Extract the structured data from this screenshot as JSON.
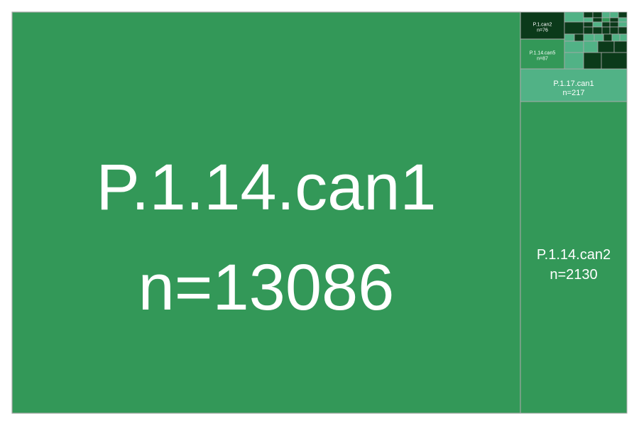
{
  "chart_data": {
    "type": "treemap",
    "colors": {
      "border": "#a9a9a9",
      "background": "#ffffff",
      "label": "#ffffff",
      "shades": [
        "#339858",
        "#51b286",
        "#2b7f48",
        "#14542b",
        "#0b3a1a",
        "#06240f"
      ]
    },
    "nodes": [
      {
        "name": "P.1.14.can1",
        "n": 13086,
        "color": "#339858",
        "label": "P.1.14.can1",
        "count_label": "n=13086"
      },
      {
        "name": "P.1.14.can2",
        "n": 2130,
        "color": "#339858",
        "label": "P.1.14.can2",
        "count_label": "n=2130"
      },
      {
        "name": "P.1.17.can1",
        "n": 217,
        "color": "#51b286",
        "label": "P.1.17.can1",
        "count_label": "n=217"
      },
      {
        "name": "P.1.14.can5",
        "n": 87,
        "color": "#339858",
        "label": "P.1.14.can5",
        "count_label": "n=87"
      },
      {
        "name": "P.1.can2",
        "n": 76,
        "color": "#0b3a1a",
        "label": "P.1.can2",
        "count_label": "n=76"
      }
    ],
    "small_cells": [
      {
        "color": "#51b286"
      },
      {
        "color": "#0b3a1a"
      },
      {
        "color": "#0b3a1a"
      },
      {
        "color": "#51b286"
      },
      {
        "color": "#51b286"
      },
      {
        "color": "#0b3a1a"
      },
      {
        "color": "#51b286"
      },
      {
        "color": "#0b3a1a"
      },
      {
        "color": "#339858"
      },
      {
        "color": "#0b3a1a"
      },
      {
        "color": "#51b286"
      },
      {
        "color": "#0b3a1a"
      },
      {
        "color": "#0b3a1a"
      },
      {
        "color": "#51b286"
      },
      {
        "color": "#0b3a1a"
      },
      {
        "color": "#0b3a1a"
      },
      {
        "color": "#51b286"
      },
      {
        "color": "#0b3a1a"
      },
      {
        "color": "#0b3a1a"
      },
      {
        "color": "#0b3a1a"
      },
      {
        "color": "#0b3a1a"
      },
      {
        "color": "#0b3a1a"
      },
      {
        "color": "#51b286"
      },
      {
        "color": "#0b3a1a"
      },
      {
        "color": "#51b286"
      },
      {
        "color": "#51b286"
      },
      {
        "color": "#0b3a1a"
      },
      {
        "color": "#51b286"
      },
      {
        "color": "#51b286"
      },
      {
        "color": "#51b286"
      },
      {
        "color": "#51b286"
      },
      {
        "color": "#0b3a1a"
      },
      {
        "color": "#0b3a1a"
      },
      {
        "color": "#51b286"
      },
      {
        "color": "#0b3a1a"
      },
      {
        "color": "#0b3a1a"
      },
      {
        "color": "#0b3a1a"
      },
      {
        "color": "#51b286"
      },
      {
        "color": "#0b3a1a"
      },
      {
        "color": "#51b286"
      },
      {
        "color": "#0b3a1a"
      },
      {
        "color": "#0b3a1a"
      },
      {
        "color": "#51b286"
      },
      {
        "color": "#0b3a1a"
      }
    ]
  }
}
